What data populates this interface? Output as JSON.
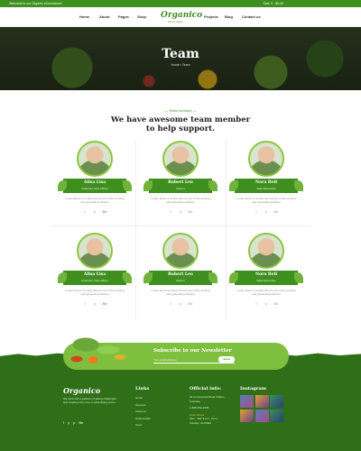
{
  "topbar": {
    "welcome": "Welcome to our Organic eCommerce!",
    "cart": "Cart: 0 - $0.00"
  },
  "nav": {
    "items": [
      "Home",
      "About",
      "Pages",
      "Shop",
      "Projects",
      "Blog",
      "Contact us"
    ],
    "logo": "Organico",
    "logo_sub": "fresh & organic"
  },
  "hero": {
    "title": "Team",
    "breadcrumb": "Home  •  Team"
  },
  "section": {
    "tag": "— Team member —",
    "title": "We have awesome team member to help support."
  },
  "members": [
    {
      "name": "Alisa Lisa",
      "role": "Customer Care Officer",
      "desc": "Lorem ipsum is simply dummy text of the printing and typesetting industry",
      "socials": [
        "f",
        "y",
        "Be"
      ]
    },
    {
      "name": "Robert Leo",
      "role": "Farmer",
      "desc": "Lorem ipsum is simply dummy text of the printing and typesetting industry",
      "socials": [
        "f",
        "y",
        "Be"
      ]
    },
    {
      "name": "Nora Bell",
      "role": "Sales Executive",
      "desc": "Lorem ipsum is simply dummy text of the printing and typesetting industry",
      "socials": [
        "f",
        "y",
        "Be"
      ]
    },
    {
      "name": "Alisa Lisa",
      "role": "Customer Care Officer",
      "desc": "Lorem ipsum is simply dummy text of the printing and typesetting industry",
      "socials": [
        "f",
        "y",
        "Be"
      ]
    },
    {
      "name": "Robert Leo",
      "role": "Farmer",
      "desc": "Lorem ipsum is simply dummy text of the printing and typesetting industry",
      "socials": [
        "f",
        "y",
        "Be"
      ]
    },
    {
      "name": "Nora Bell",
      "role": "Sales Executive",
      "desc": "Lorem ipsum is simply dummy text of the printing and typesetting industry",
      "socials": [
        "f",
        "y",
        "Be"
      ]
    }
  ],
  "newsletter": {
    "title": "Subscribe to our Newsletter",
    "placeholder": "Your email address",
    "button": "Send"
  },
  "footer": {
    "logo": "Organico",
    "about": "We work with a passion of taking challenges and creating new ones in advertising sector.",
    "socials": [
      "f",
      "y",
      "p",
      "Be"
    ],
    "links_title": "Links",
    "links": [
      "Home",
      "Services",
      "About us",
      "Testimonials",
      "Team"
    ],
    "info_title": "Official info:",
    "address": "30 Commercial Road Fratton, Australia",
    "phone": "1-888-452-1505",
    "open_label": "Open Hours:",
    "hours1": "Mon - Sat: 8 am - 5 pm,",
    "hours2": "Sunday: CLOSED",
    "insta_title": "Instagram"
  },
  "colors": {
    "brand": "#3f8f1f",
    "accent": "#7fbf3f",
    "footer": "#2f6f17"
  }
}
